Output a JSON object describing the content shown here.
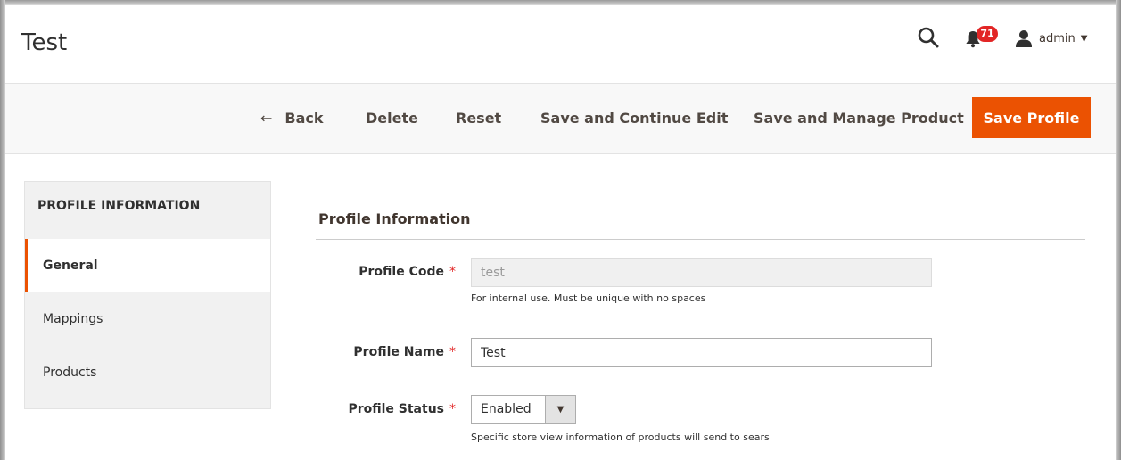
{
  "page": {
    "title": "Test"
  },
  "header": {
    "notifications_count": "71",
    "user_name": "admin"
  },
  "toolbar": {
    "back_arrow": "←",
    "back_label": "Back",
    "delete_label": "Delete",
    "reset_label": "Reset",
    "save_continue_label": "Save and Continue Edit",
    "save_manage_label": "Save and Manage Product",
    "save_profile_label": "Save Profile"
  },
  "sidebar": {
    "title": "PROFILE INFORMATION",
    "items": [
      {
        "label": "General",
        "active": true
      },
      {
        "label": "Mappings",
        "active": false
      },
      {
        "label": "Products",
        "active": false
      }
    ]
  },
  "form": {
    "section_title": "Profile Information",
    "required_marker": "*",
    "profile_code": {
      "label": "Profile Code",
      "value": "test",
      "note": "For internal use. Must be unique with no spaces"
    },
    "profile_name": {
      "label": "Profile Name",
      "value": "Test"
    },
    "profile_status": {
      "label": "Profile Status",
      "value": "Enabled",
      "note": "Specific store view information of products will send to sears"
    }
  },
  "colors": {
    "accent": "#eb5202",
    "badge": "#e22626",
    "required": "#e22626"
  },
  "icons": [
    "search-icon",
    "bell-icon",
    "user-icon",
    "chevron-down-icon",
    "arrow-left-icon"
  ]
}
